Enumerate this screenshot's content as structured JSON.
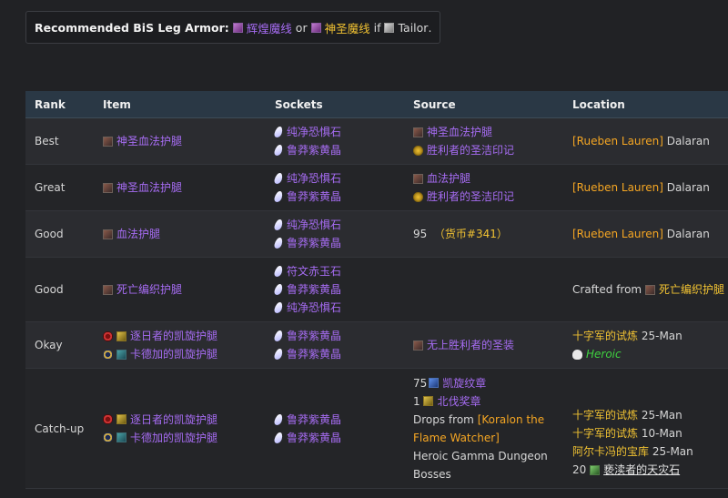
{
  "recommendation": {
    "lead": "Recommended BiS Leg Armor:",
    "option1": "辉煌魔线",
    "or": "or",
    "option2": "神圣魔线",
    "if": "if",
    "profession": "Tailor",
    "period": "."
  },
  "table": {
    "headers": {
      "rank": "Rank",
      "item": "Item",
      "sockets": "Sockets",
      "source": "Source",
      "location": "Location"
    }
  },
  "rows": [
    {
      "rank": "Best",
      "item": "神圣血法护腿",
      "sockets": [
        "纯净恐惧石",
        "鲁莽紫黄晶"
      ],
      "source": [
        "神圣血法护腿",
        "胜利者的圣洁印记"
      ],
      "location_npc": "[Rueben Lauren]",
      "location_zone": "Dalaran"
    },
    {
      "rank": "Great",
      "item": "神圣血法护腿",
      "sockets": [
        "纯净恐惧石",
        "鲁莽紫黄晶"
      ],
      "source": [
        "血法护腿",
        "胜利者的圣洁印记"
      ],
      "location_npc": "[Rueben Lauren]",
      "location_zone": "Dalaran"
    },
    {
      "rank": "Good",
      "item": "血法护腿",
      "sockets": [
        "纯净恐惧石",
        "鲁莽紫黄晶"
      ],
      "source_amount": "95",
      "source_currency": "（货币#341）",
      "location_npc": "[Rueben Lauren]",
      "location_zone": "Dalaran"
    },
    {
      "rank": "Good",
      "item": "死亡编织护腿",
      "sockets": [
        "符文赤玉石",
        "鲁莽紫黄晶",
        "纯净恐惧石"
      ],
      "source": "",
      "location_prefix": "Crafted from",
      "location_item": "死亡编织护腿"
    },
    {
      "rank": "Okay",
      "items": [
        "逐日者的凯旋护腿",
        "卡德加的凯旋护腿"
      ],
      "sockets": [
        "鲁莽紫黄晶",
        "鲁莽紫黄晶"
      ],
      "source": "无上胜利者的圣装",
      "location_raid": "十字军的试炼",
      "location_size": "25-Man",
      "location_mode": "Heroic"
    },
    {
      "rank": "Catch-up",
      "items": [
        "逐日者的凯旋护腿",
        "卡德加的凯旋护腿"
      ],
      "sockets": [
        "鲁莽紫黄晶",
        "鲁莽紫黄晶"
      ],
      "source_line1_amount": "75",
      "source_line1_item": "凯旋纹章",
      "source_line2_amount": "1",
      "source_line2_item": "北伐奖章",
      "source_drops_prefix": "Drops from",
      "source_drops_boss": "[Koralon the Flame Watcher]",
      "source_heroic": "Heroic Gamma Dungeon Bosses",
      "locations": [
        {
          "name": "十字军的试炼",
          "size": "25-Man"
        },
        {
          "name": "十字军的试炼",
          "size": "10-Man"
        },
        {
          "name": "阿尔卡冯的宝库",
          "size": "25-Man"
        }
      ],
      "location_last_amount": "20",
      "location_last_item": "亵渎者的天灾石"
    }
  ]
}
